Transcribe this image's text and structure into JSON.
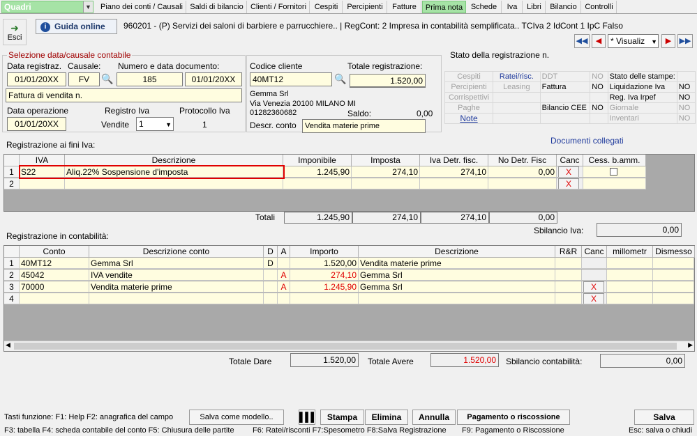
{
  "menu": {
    "quadri": "Quadri",
    "tabs": [
      "Piano dei conti / Causali",
      "Saldi di bilancio",
      "Clienti / Fornitori",
      "Cespiti",
      "Percipienti",
      "Fatture",
      "Prima nota",
      "Schede",
      "Iva",
      "Libri",
      "Bilancio",
      "Controlli"
    ],
    "active": "Prima nota"
  },
  "toolbar": {
    "exit": "Esci",
    "guide": "Guida online",
    "info": "960201 - (P) Servizi dei saloni di barbiere e parrucchiere.. | RegCont: 2 Impresa  in contabilità semplificata..  TCIva 2 IdCont 1 IpC Falso",
    "view": "* Visualiz"
  },
  "selection": {
    "title": "Selezione data/causale contabile",
    "data_reg_label": "Data registraz.",
    "causale_label": "Causale:",
    "numdata_label": "Numero e data documento:",
    "data_reg": "01/01/20XX",
    "causale": "FV",
    "numero": "185",
    "data_doc": "01/01/20XX",
    "causale_desc": "Fattura di vendita n.",
    "data_op_label": "Data operazione",
    "data_op": "01/01/20XX",
    "registro_label": "Registro Iva",
    "vendite_label": "Vendite",
    "registro": "1",
    "protocollo_label": "Protocollo Iva",
    "protocollo": "1"
  },
  "client": {
    "codice_label": "Codice cliente",
    "codice": "40MT12",
    "totale_label": "Totale registrazione:",
    "totale": "1.520,00",
    "name": "Gemma Srl",
    "address": "Via Venezia 20100 MILANO MI",
    "piva": "01282360682",
    "saldo_label": "Saldo:",
    "saldo": "0,00",
    "descr_label": "Descr. conto",
    "descr": "Vendita materie prime"
  },
  "status": {
    "title": "Stato della registrazione n.",
    "rows": [
      [
        "Cespiti",
        "Ratei/risc.",
        "DDT",
        "NO",
        "Stato delle stampe:",
        ""
      ],
      [
        "Percipienti",
        "Leasing",
        "Fattura",
        "NO",
        "Liquidazione Iva",
        "NO"
      ],
      [
        "Corrispettivi",
        "",
        "",
        "",
        "Reg. Iva Irpef",
        "NO"
      ],
      [
        "Paghe",
        "",
        "Bilancio CEE",
        "NO",
        "Giornale",
        "NO"
      ],
      [
        "Note",
        "",
        "",
        "",
        "Inventari",
        "NO"
      ]
    ],
    "documents": "Documenti collegati"
  },
  "iva": {
    "title": "Registrazione ai fini Iva:",
    "headers": [
      "IVA",
      "Descrizione",
      "Imponibile",
      "Imposta",
      "Iva Detr. fisc.",
      "No Detr. Fisc",
      "Canc",
      "Cess. b.amm."
    ],
    "rows": [
      {
        "n": "1",
        "code": "S22",
        "desc": "Aliq.22% Sospensione d'imposta",
        "imp": "1.245,90",
        "imposta": "274,10",
        "detr": "274,10",
        "nodetr": "0,00"
      },
      {
        "n": "2",
        "code": "",
        "desc": "",
        "imp": "",
        "imposta": "",
        "detr": "",
        "nodetr": ""
      }
    ],
    "totali_label": "Totali",
    "tot_imp": "1.245,90",
    "tot_imposta": "274,10",
    "tot_detr": "274,10",
    "tot_nodetr": "0,00",
    "sbilancio_label": "Sbilancio Iva:",
    "sbilancio": "0,00",
    "x": "X"
  },
  "cont": {
    "title": "Registrazione in contabilità:",
    "headers": [
      "Conto",
      "Descrizione conto",
      "D",
      "A",
      "Importo",
      "Descrizione",
      "R&R",
      "Canc",
      "millometr",
      "Dismesso"
    ],
    "rows": [
      {
        "n": "1",
        "conto": "40MT12",
        "desc": "Gemma Srl",
        "d": "D",
        "a": "",
        "imp": "1.520,00",
        "descr": "Vendita materie prime"
      },
      {
        "n": "2",
        "conto": "45042",
        "desc": "IVA vendite",
        "d": "",
        "a": "A",
        "imp": "274,10",
        "descr": "Gemma Srl"
      },
      {
        "n": "3",
        "conto": "70000",
        "desc": "Vendita materie prime",
        "d": "",
        "a": "A",
        "imp": "1.245,90",
        "descr": "Gemma Srl"
      },
      {
        "n": "4",
        "conto": "",
        "desc": "",
        "d": "",
        "a": "",
        "imp": "",
        "descr": ""
      }
    ],
    "dare_label": "Totale Dare",
    "dare": "1.520,00",
    "avere_label": "Totale Avere",
    "avere": "1.520,00",
    "sbil_label": "Sbilancio contabilità:",
    "sbil": "0,00"
  },
  "footer": {
    "keys1": "Tasti funzione:  F1: Help  F2: anagrafica del campo",
    "keys2": "F3: tabella   F4: scheda contabile del conto   F5: Chiusura delle partite",
    "keys3": "F6: Ratei/risconti   F7:Spesometro   F8:Salva Registrazione",
    "keys4": "F9: Pagamento o Riscossione",
    "esc": "Esc: salva o chiudi",
    "salva_modello": "Salva come modello..",
    "stampa": "Stampa",
    "elimina": "Elimina",
    "annulla": "Annulla",
    "pagamento": "Pagamento o riscossione",
    "salva": "Salva"
  }
}
